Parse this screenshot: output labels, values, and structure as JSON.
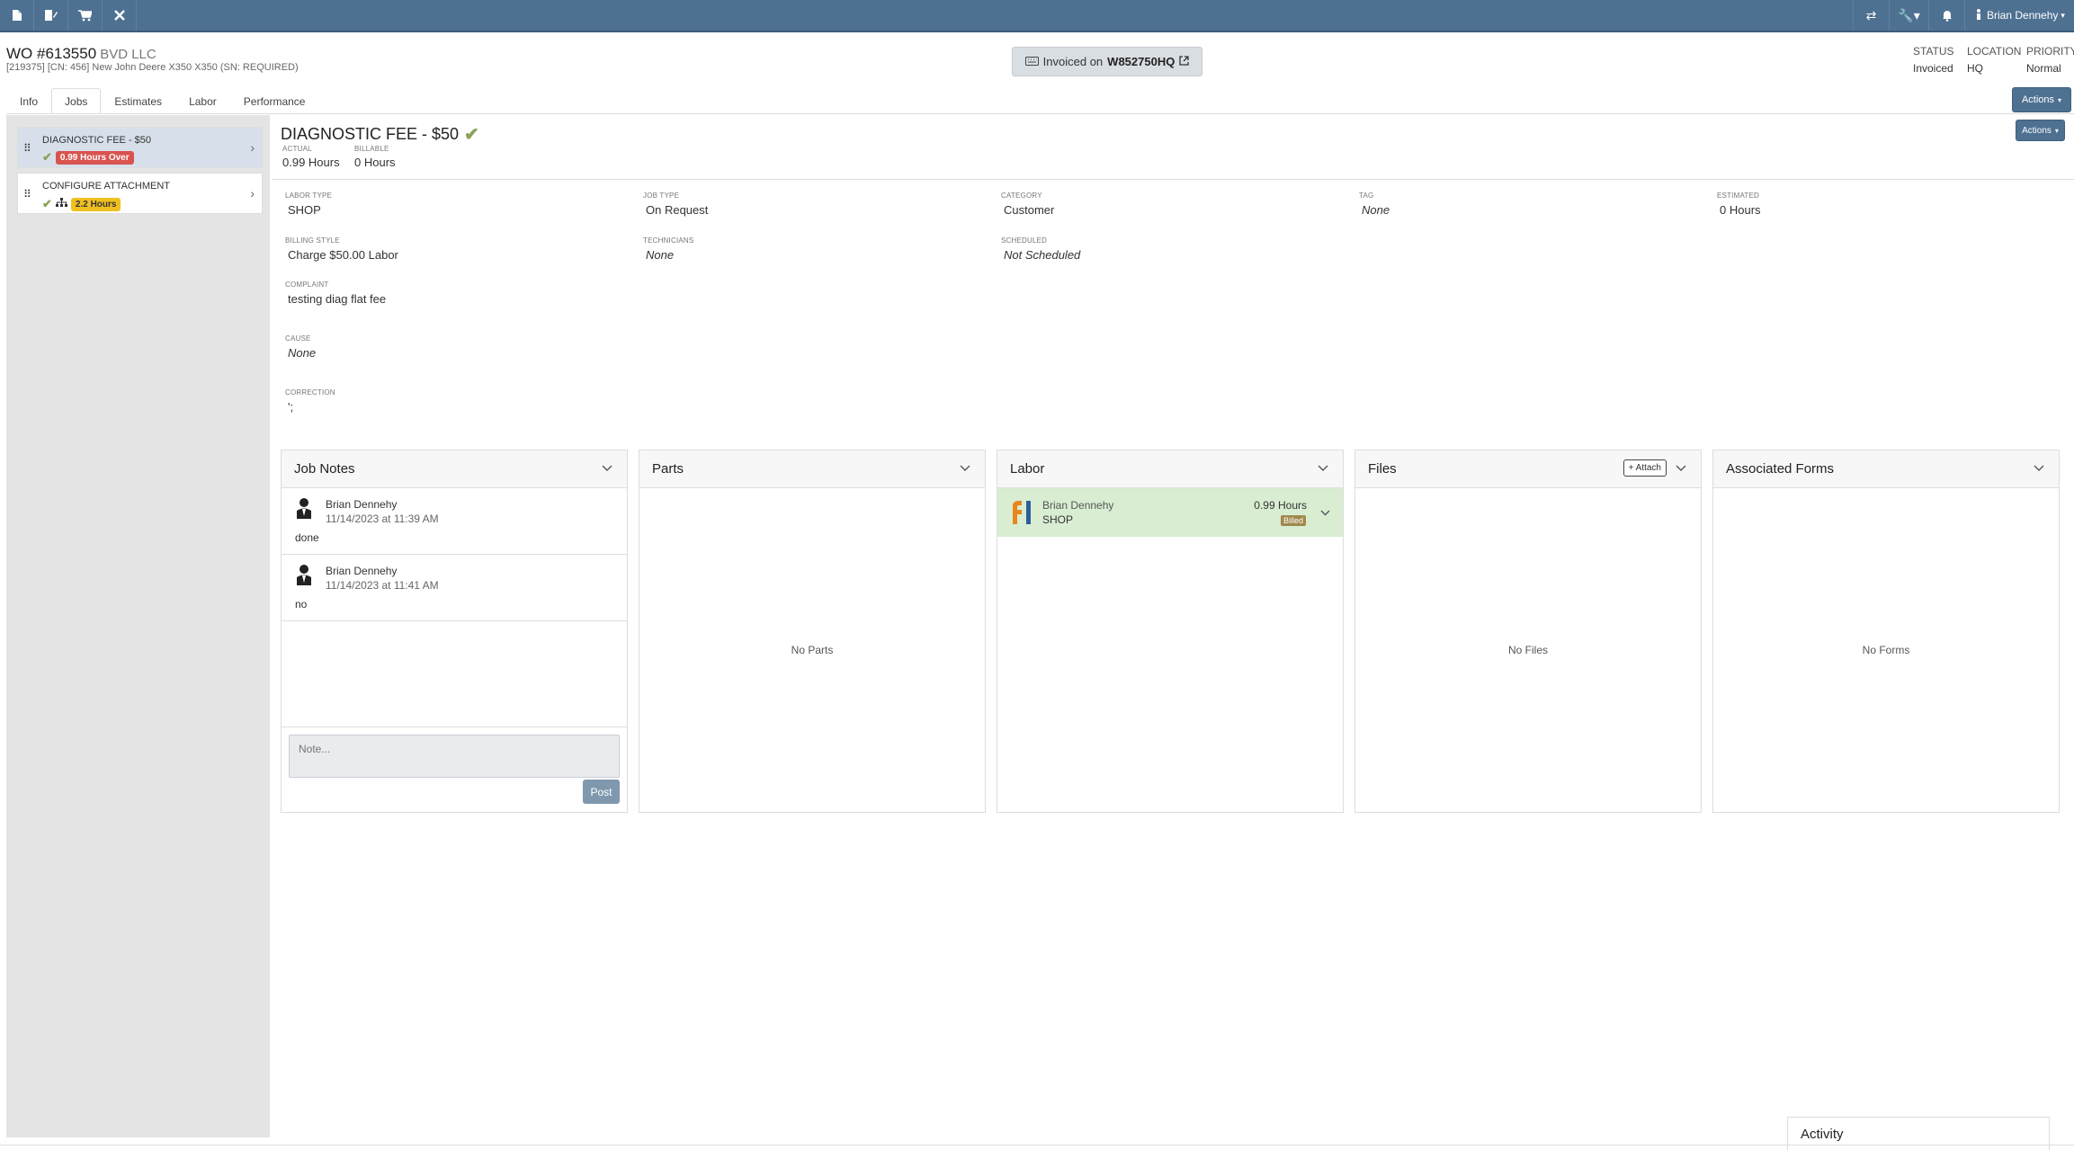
{
  "topnav": {
    "left_icons": [
      "document-icon",
      "edit-icon",
      "cart-icon",
      "tools-icon"
    ],
    "right_icons": [
      "sync-icon",
      "wrench-icon",
      "bell-icon"
    ],
    "user_name": "Brian Dennehy"
  },
  "header": {
    "wo_number": "WO #613550",
    "customer": "BVD LLC",
    "subtitle": "[219375] [CN: 456] New John Deere X350 X350 (SN: REQUIRED)",
    "invoiced_prefix": "Invoiced on",
    "invoice_number": "W852750HQ",
    "status_label": "STATUS",
    "status_value": "Invoiced",
    "location_label": "LOCATION",
    "location_value": "HQ",
    "priority_label": "PRIORITY",
    "priority_value": "Normal"
  },
  "tabs": [
    "Info",
    "Jobs",
    "Estimates",
    "Labor",
    "Performance"
  ],
  "actions_label": "Actions",
  "jobs": [
    {
      "name": "DIAGNOSTIC FEE - $50",
      "badge": "0.99 Hours Over"
    },
    {
      "name": "CONFIGURE ATTACHMENT",
      "badge": "2.2 Hours"
    }
  ],
  "job_detail": {
    "title": "DIAGNOSTIC FEE - $50",
    "actual_label": "ACTUAL",
    "actual_value": "0.99 Hours",
    "billable_label": "BILLABLE",
    "billable_value": "0 Hours",
    "fields": {
      "labor_type": {
        "label": "LABOR TYPE",
        "value": "SHOP"
      },
      "job_type": {
        "label": "JOB TYPE",
        "value": "On Request"
      },
      "category": {
        "label": "CATEGORY",
        "value": "Customer"
      },
      "tag": {
        "label": "TAG",
        "value": "None"
      },
      "estimated": {
        "label": "ESTIMATED",
        "value": "0 Hours"
      },
      "billing_style": {
        "label": "BILLING STYLE",
        "value": "Charge $50.00 Labor"
      },
      "technicians": {
        "label": "TECHNICIANS",
        "value": "None"
      },
      "scheduled": {
        "label": "SCHEDULED",
        "value": "Not Scheduled"
      },
      "complaint": {
        "label": "COMPLAINT",
        "value": "testing diag flat fee"
      },
      "cause": {
        "label": "CAUSE",
        "value": "None"
      },
      "correction": {
        "label": "CORRECTION",
        "value": "';"
      }
    }
  },
  "panels": {
    "job_notes": {
      "title": "Job Notes",
      "notes": [
        {
          "author": "Brian Dennehy",
          "date": "11/14/2023 at 11:39 AM",
          "text": "done"
        },
        {
          "author": "Brian Dennehy",
          "date": "11/14/2023 at 11:41 AM",
          "text": "no"
        }
      ],
      "placeholder": "Note...",
      "post_label": "Post"
    },
    "parts": {
      "title": "Parts",
      "empty": "No Parts"
    },
    "labor": {
      "title": "Labor",
      "entry": {
        "name": "Brian Dennehy",
        "type": "SHOP",
        "hours": "0.99 Hours",
        "status": "Billed"
      }
    },
    "files": {
      "title": "Files",
      "attach_label": "+ Attach",
      "empty": "No Files"
    },
    "forms": {
      "title": "Associated Forms",
      "empty": "No Forms"
    }
  },
  "activity_label": "Activity"
}
